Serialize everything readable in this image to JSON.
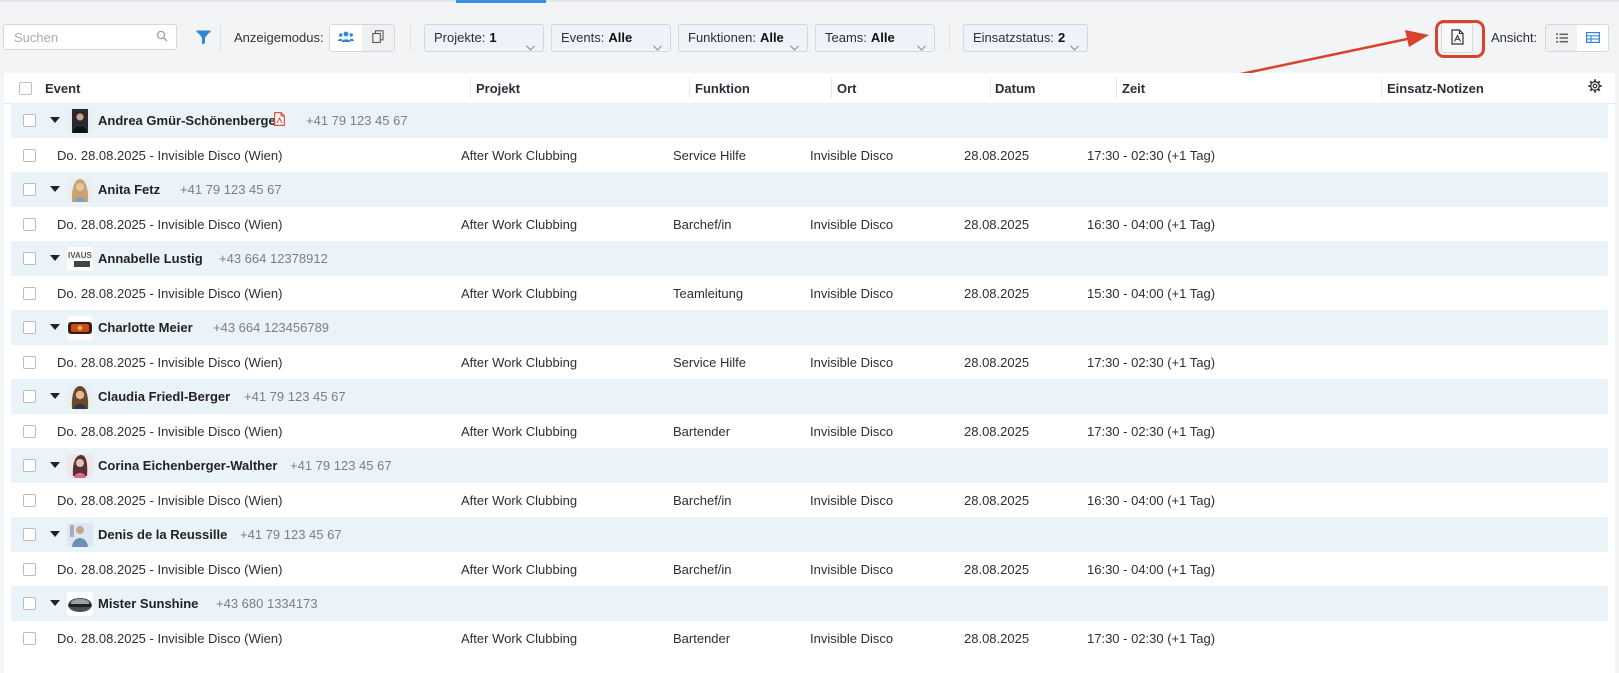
{
  "toolbar": {
    "search_placeholder": "Suchen",
    "display_mode_label": "Anzeigemodus:",
    "filters": [
      {
        "label": "Projekte:",
        "value": "1"
      },
      {
        "label": "Events:",
        "value": "Alle"
      },
      {
        "label": "Funktionen:",
        "value": "Alle"
      },
      {
        "label": "Teams:",
        "value": "Alle"
      },
      {
        "label": "Einsatzstatus:",
        "value": "2"
      }
    ],
    "view_label": "Ansicht:"
  },
  "colors": {
    "accent": "#3b8fe0",
    "group_row_bg": "#eaf3f8",
    "highlight": "#d9422b"
  },
  "table": {
    "headers": [
      "Event",
      "Projekt",
      "Funktion",
      "Ort",
      "Datum",
      "Zeit",
      "Einsatz-Notizen"
    ],
    "groups": [
      {
        "name": "Andrea Gmür-Schönenberger",
        "phone": "+41 79 123 45 67",
        "has_document": true,
        "event": "Do. 28.08.2025 - Invisible Disco (Wien)",
        "project": "After Work Clubbing",
        "function": "Service Hilfe",
        "location": "Invisible Disco",
        "date": "28.08.2025",
        "time": "17:30 - 02:30 (+1 Tag)",
        "notes": ""
      },
      {
        "name": "Anita Fetz",
        "phone": "+41 79 123 45 67",
        "has_document": false,
        "event": "Do. 28.08.2025 - Invisible Disco (Wien)",
        "project": "After Work Clubbing",
        "function": "Barchef/in",
        "location": "Invisible Disco",
        "date": "28.08.2025",
        "time": "16:30 - 04:00 (+1 Tag)",
        "notes": ""
      },
      {
        "name": "Annabelle Lustig",
        "phone": "+43 664 12378912",
        "has_document": false,
        "event": "Do. 28.08.2025 - Invisible Disco (Wien)",
        "project": "After Work Clubbing",
        "function": "Teamleitung",
        "location": "Invisible Disco",
        "date": "28.08.2025",
        "time": "15:30 - 04:00 (+1 Tag)",
        "notes": ""
      },
      {
        "name": "Charlotte Meier",
        "phone": "+43 664 123456789",
        "has_document": false,
        "event": "Do. 28.08.2025 - Invisible Disco (Wien)",
        "project": "After Work Clubbing",
        "function": "Service Hilfe",
        "location": "Invisible Disco",
        "date": "28.08.2025",
        "time": "17:30 - 02:30 (+1 Tag)",
        "notes": ""
      },
      {
        "name": "Claudia Friedl-Berger",
        "phone": "+41 79 123 45 67",
        "has_document": false,
        "event": "Do. 28.08.2025 - Invisible Disco (Wien)",
        "project": "After Work Clubbing",
        "function": "Bartender",
        "location": "Invisible Disco",
        "date": "28.08.2025",
        "time": "17:30 - 02:30 (+1 Tag)",
        "notes": ""
      },
      {
        "name": "Corina Eichenberger-Walther",
        "phone": "+41 79 123 45 67",
        "has_document": false,
        "event": "Do. 28.08.2025 - Invisible Disco (Wien)",
        "project": "After Work Clubbing",
        "function": "Barchef/in",
        "location": "Invisible Disco",
        "date": "28.08.2025",
        "time": "16:30 - 04:00 (+1 Tag)",
        "notes": ""
      },
      {
        "name": "Denis de la Reussille",
        "phone": "+41 79 123 45 67",
        "has_document": false,
        "event": "Do. 28.08.2025 - Invisible Disco (Wien)",
        "project": "After Work Clubbing",
        "function": "Barchef/in",
        "location": "Invisible Disco",
        "date": "28.08.2025",
        "time": "16:30 - 04:00 (+1 Tag)",
        "notes": ""
      },
      {
        "name": "Mister Sunshine",
        "phone": "+43 680 1334173",
        "has_document": false,
        "event": "Do. 28.08.2025 - Invisible Disco (Wien)",
        "project": "After Work Clubbing",
        "function": "Bartender",
        "location": "Invisible Disco",
        "date": "28.08.2025",
        "time": "17:30 - 02:30 (+1 Tag)",
        "notes": ""
      }
    ]
  }
}
